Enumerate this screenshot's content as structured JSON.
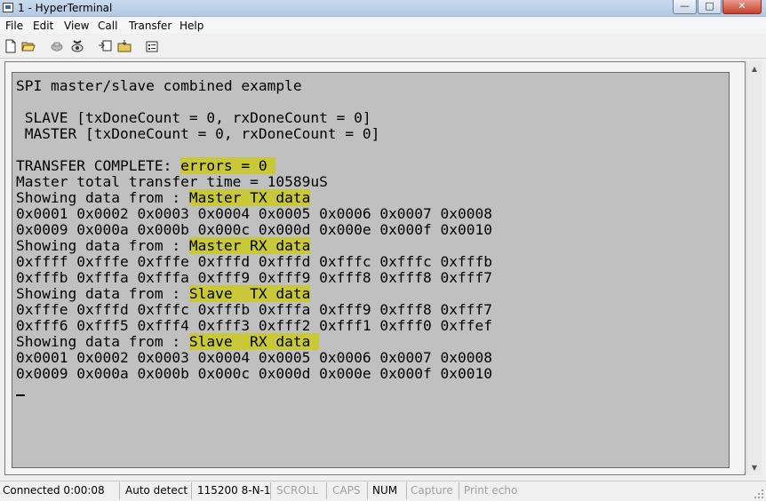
{
  "window": {
    "title": "1 - HyperTerminal",
    "minimize": "0",
    "maximize": "1",
    "close": "r"
  },
  "menu": [
    "File",
    "Edit",
    "View",
    "Call",
    "Transfer",
    "Help"
  ],
  "toolbar_icons": [
    "new-icon",
    "open-icon",
    "disconnect-icon",
    "connect-icon",
    "send-icon",
    "receive-icon",
    "properties-icon"
  ],
  "terminal": {
    "lines": [
      {
        "text": "SPI master/slave combined example",
        "highlight": ""
      },
      {
        "text": "",
        "highlight": ""
      },
      {
        "text": " SLAVE [txDoneCount = 0, rxDoneCount = 0]",
        "highlight": ""
      },
      {
        "text": " MASTER [txDoneCount = 0, rxDoneCount = 0]",
        "highlight": ""
      },
      {
        "text": "",
        "highlight": ""
      },
      {
        "text": "TRANSFER COMPLETE: ",
        "highlight": "errors = 0 "
      },
      {
        "text": "Master total transfer time = 10589uS",
        "highlight": ""
      },
      {
        "text": "Showing data from : ",
        "highlight": "Master TX data"
      },
      {
        "text": "0x0001 0x0002 0x0003 0x0004 0x0005 0x0006 0x0007 0x0008",
        "highlight": ""
      },
      {
        "text": "0x0009 0x000a 0x000b 0x000c 0x000d 0x000e 0x000f 0x0010",
        "highlight": ""
      },
      {
        "text": "Showing data from : ",
        "highlight": "Master RX data"
      },
      {
        "text": "0xffff 0xfffe 0xfffe 0xfffd 0xfffd 0xfffc 0xfffc 0xfffb",
        "highlight": ""
      },
      {
        "text": "0xfffb 0xfffa 0xfffa 0xfff9 0xfff9 0xfff8 0xfff8 0xfff7",
        "highlight": ""
      },
      {
        "text": "Showing data from : ",
        "highlight": "Slave  TX data"
      },
      {
        "text": "0xfffe 0xfffd 0xfffc 0xfffb 0xfffa 0xfff9 0xfff8 0xfff7",
        "highlight": ""
      },
      {
        "text": "0xfff6 0xfff5 0xfff4 0xfff3 0xfff2 0xfff1 0xfff0 0xffef",
        "highlight": ""
      },
      {
        "text": "Showing data from : ",
        "highlight": "Slave  RX data "
      },
      {
        "text": "0x0001 0x0002 0x0003 0x0004 0x0005 0x0006 0x0007 0x0008",
        "highlight": ""
      },
      {
        "text": "0x0009 0x000a 0x000b 0x000c 0x000d 0x000e 0x000f 0x0010",
        "highlight": ""
      }
    ]
  },
  "status": [
    {
      "name": "status-connected",
      "text": "Connected 0:00:08",
      "dim": false
    },
    {
      "name": "status-detect",
      "text": "Auto detect",
      "dim": false
    },
    {
      "name": "status-baud",
      "text": "115200 8-N-1",
      "dim": false
    },
    {
      "name": "status-scroll",
      "text": "SCROLL",
      "dim": true
    },
    {
      "name": "status-caps",
      "text": "CAPS",
      "dim": true
    },
    {
      "name": "status-num",
      "text": "NUM",
      "dim": false
    },
    {
      "name": "status-capture",
      "text": "Capture",
      "dim": true
    },
    {
      "name": "status-print-echo",
      "text": "Print echo",
      "dim": true
    }
  ],
  "colors": {
    "highlight": "#c8c838",
    "terminal_bg": "#c0c0c0"
  }
}
